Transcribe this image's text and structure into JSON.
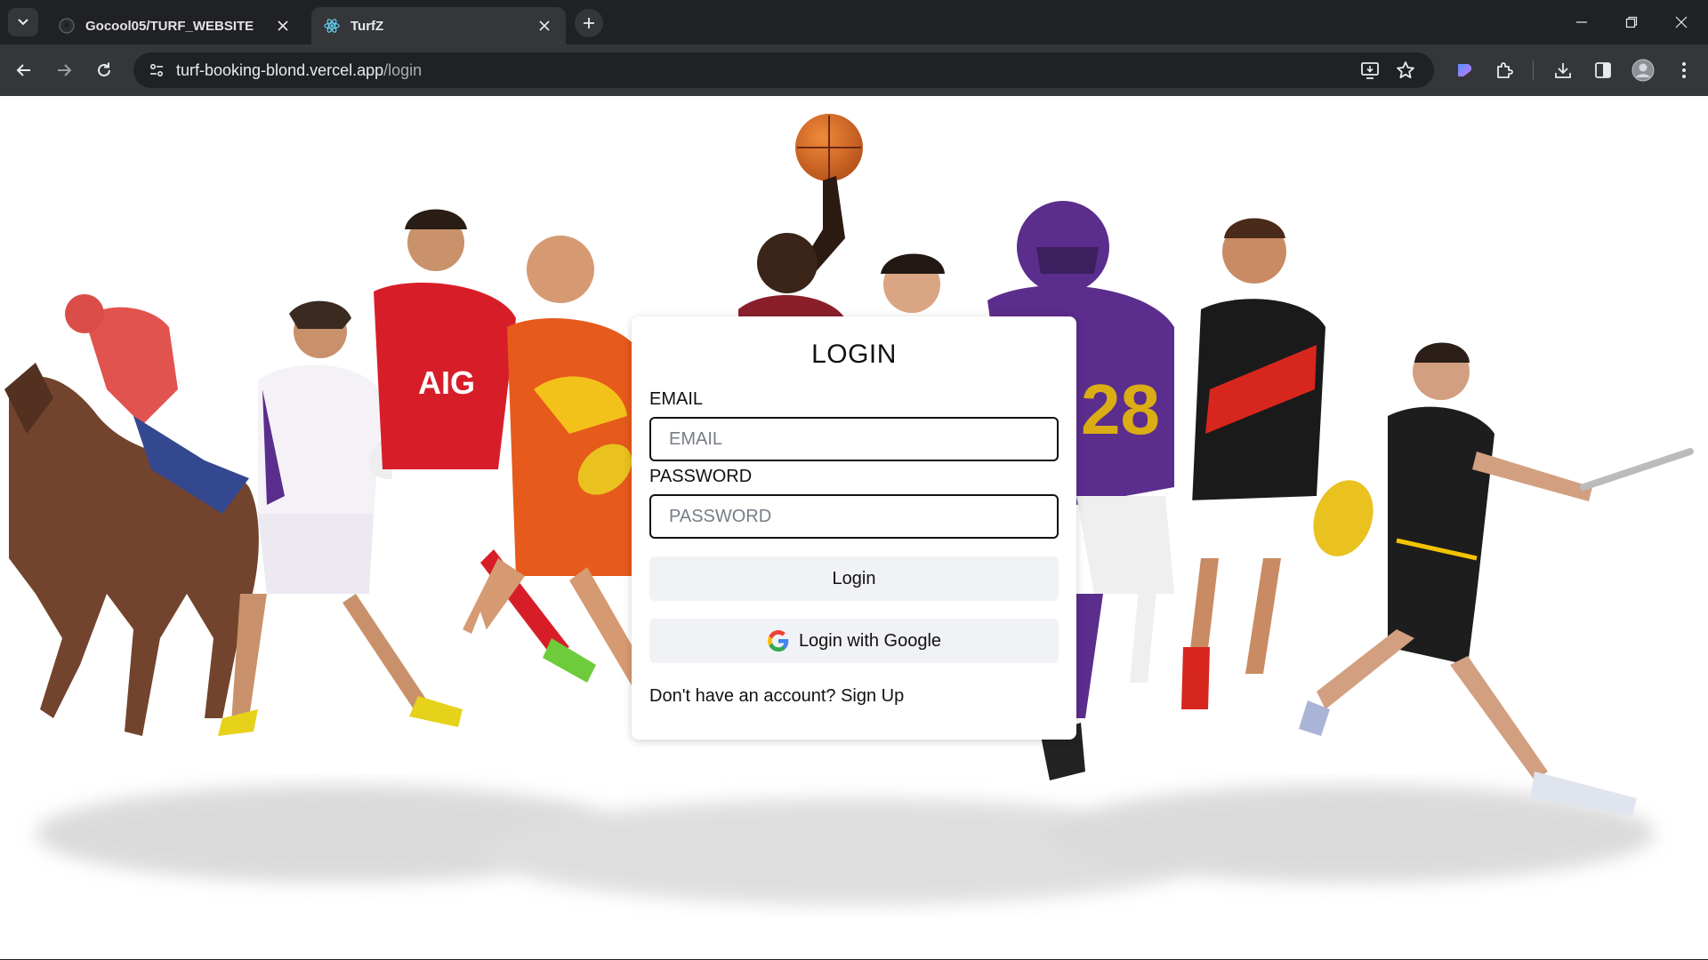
{
  "browser": {
    "tabs": [
      {
        "title": "Gocool05/TURF_WEBSITE",
        "active": false,
        "icon": "github-icon"
      },
      {
        "title": "TurfZ",
        "active": true,
        "icon": "react-icon"
      }
    ],
    "url_host": "turf-booking-blond.vercel.app",
    "url_path": "/login",
    "colors": {
      "frame": "#202124",
      "toolbar": "#35363a",
      "text": "#e8eaed"
    }
  },
  "page": {
    "background_image": "sports-athletes-collage",
    "card": {
      "title": "LOGIN",
      "email_label": "EMAIL",
      "email_placeholder": "EMAIL",
      "password_label": "PASSWORD",
      "password_placeholder": "PASSWORD",
      "login_button": "Login",
      "google_button": "Login with Google",
      "signup_prompt": "Don't have an account?",
      "signup_link": "Sign Up"
    },
    "colors": {
      "button_bg": "#f0f2f5",
      "input_border": "#111111",
      "card_bg": "#ffffff"
    }
  }
}
